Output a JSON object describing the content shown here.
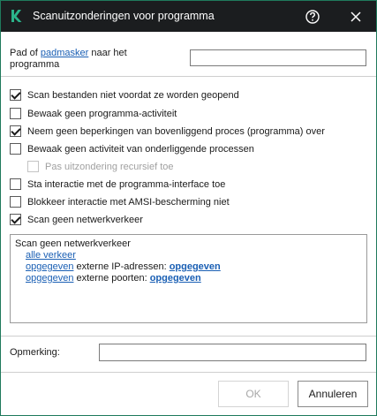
{
  "window": {
    "title": "Scanuitzonderingen voor programma",
    "accent_color": "#1f7a5c",
    "titlebar_color": "#1b1d1f"
  },
  "path": {
    "label_prefix": "Pad of ",
    "link_text": "padmasker",
    "label_suffix": " naar het programma",
    "value": ""
  },
  "options": [
    {
      "label": "Scan bestanden niet voordat ze worden geopend",
      "checked": true,
      "disabled": false
    },
    {
      "label": "Bewaak geen programma-activiteit",
      "checked": false,
      "disabled": false
    },
    {
      "label": "Neem geen beperkingen van bovenliggend proces (programma) over",
      "checked": true,
      "disabled": false
    },
    {
      "label": "Bewaak geen activiteit van onderliggende processen",
      "checked": false,
      "disabled": false
    },
    {
      "label": "Pas uitzondering recursief toe",
      "checked": false,
      "disabled": true
    },
    {
      "label": "Sta interactie met de programma-interface toe",
      "checked": false,
      "disabled": false
    },
    {
      "label": "Blokkeer interactie met AMSI-bescherming niet",
      "checked": false,
      "disabled": false
    },
    {
      "label": "Scan geen netwerkverkeer",
      "checked": true,
      "disabled": false
    }
  ],
  "summary": {
    "heading": "Scan geen netwerkverkeer",
    "all_traffic_link": "alle verkeer",
    "ip_line": {
      "link1": "opgegeven",
      "text": " externe IP-adressen: ",
      "link2": "opgegeven"
    },
    "port_line": {
      "link1": "opgegeven",
      "text": " externe poorten: ",
      "link2": "opgegeven"
    }
  },
  "remark": {
    "label": "Opmerking:",
    "value": ""
  },
  "buttons": {
    "ok": "OK",
    "cancel": "Annuleren"
  },
  "icons": {
    "logo": "kaspersky-logo-icon",
    "help": "help-circle-icon",
    "close": "close-icon"
  }
}
